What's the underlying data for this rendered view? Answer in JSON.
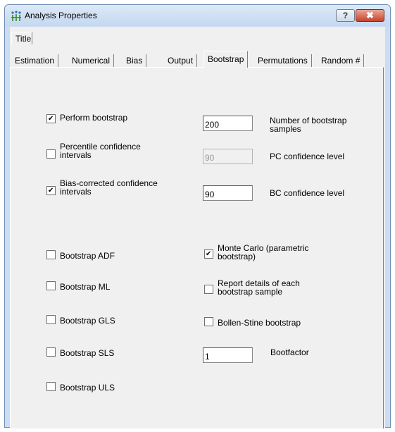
{
  "window": {
    "title": "Analysis Properties",
    "help_label": "?",
    "close_label": "✖"
  },
  "tabs": {
    "top_row": [
      "Title"
    ],
    "bottom_row": [
      "Estimation",
      "Numerical",
      "Bias",
      "Output",
      "Bootstrap",
      "Permutations",
      "Random #"
    ],
    "selected": "Bootstrap"
  },
  "bootstrap": {
    "perform_bootstrap": {
      "label": "Perform bootstrap",
      "checked": true
    },
    "num_samples": {
      "label_line1": "Number of bootstrap",
      "label_line2": "samples",
      "value": "200"
    },
    "percentile_ci": {
      "label_line1": "Percentile confidence",
      "label_line2": "intervals",
      "checked": false
    },
    "pc_level": {
      "label": "PC confidence level",
      "value": "90",
      "disabled": true
    },
    "bias_corrected_ci": {
      "label_line1": "Bias-corrected confidence",
      "label_line2": "intervals",
      "checked": true
    },
    "bc_level": {
      "label": "BC confidence level",
      "value": "90"
    },
    "bootstrap_adf": {
      "label": "Bootstrap ADF",
      "checked": false
    },
    "bootstrap_ml": {
      "label": "Bootstrap ML",
      "checked": false
    },
    "bootstrap_gls": {
      "label": "Bootstrap GLS",
      "checked": false
    },
    "bootstrap_sls": {
      "label": "Bootstrap SLS",
      "checked": false
    },
    "bootstrap_uls": {
      "label": "Bootstrap ULS",
      "checked": false
    },
    "monte_carlo": {
      "label_line1": "Monte Carlo (parametric",
      "label_line2": "bootstrap)",
      "checked": true
    },
    "report_details": {
      "label_line1": "Report details of each",
      "label_line2": "bootstrap sample",
      "checked": false
    },
    "bollen_stine": {
      "label": "Bollen-Stine bootstrap",
      "checked": false
    },
    "bootfactor": {
      "label": "Bootfactor",
      "value": "1"
    }
  }
}
